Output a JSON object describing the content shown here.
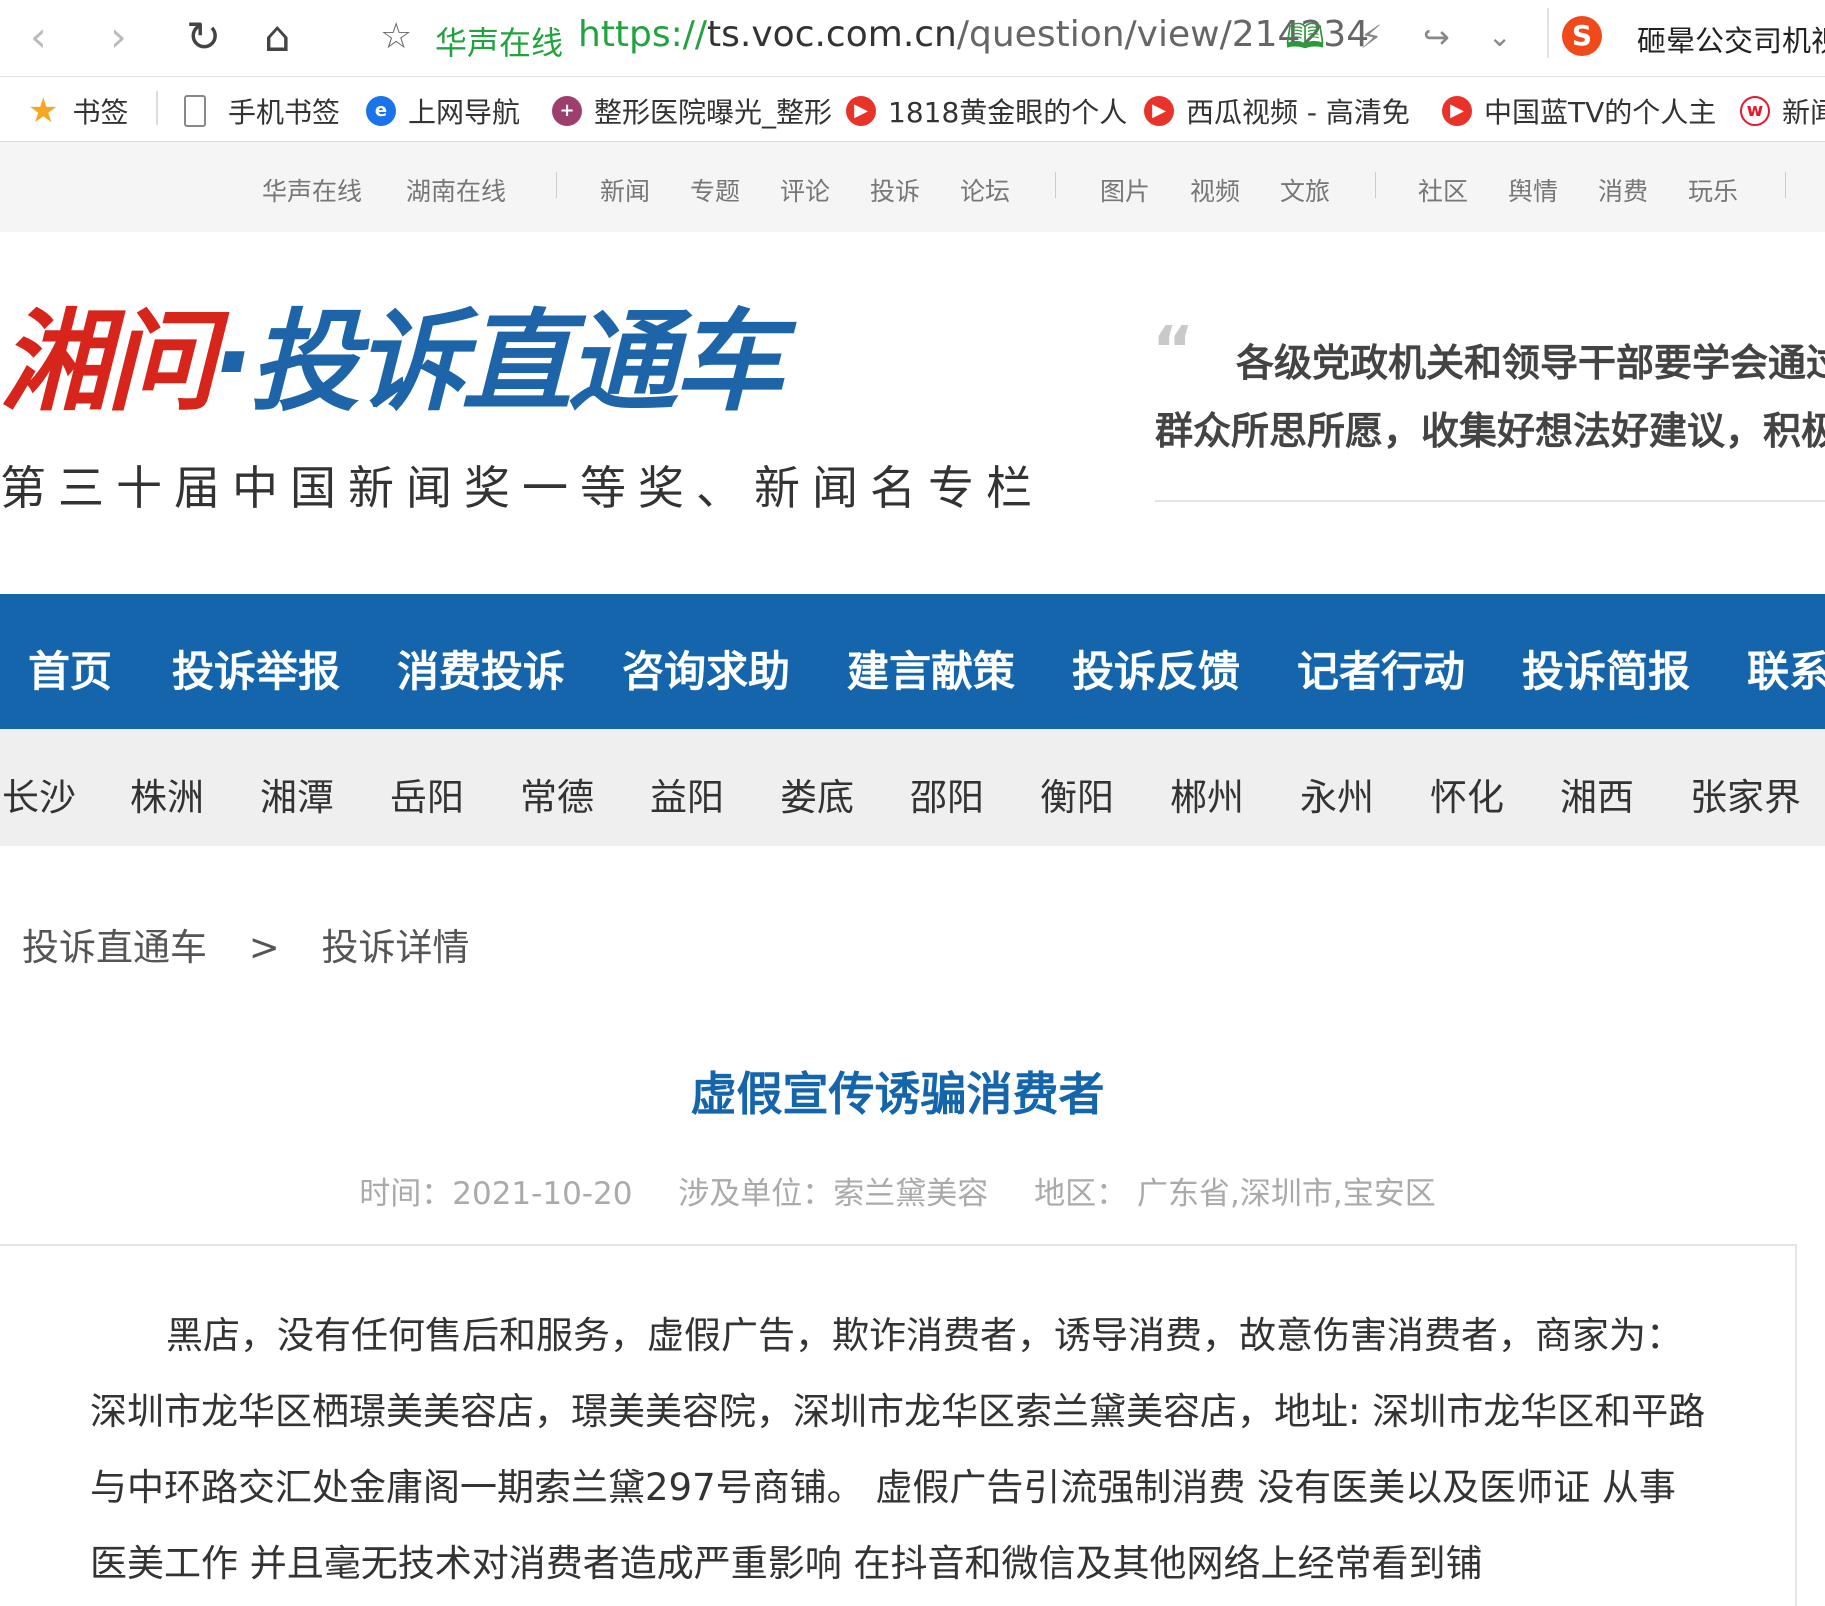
{
  "browser": {
    "site_name": "华声在线",
    "url_scheme": "https://",
    "url_host": "ts.voc.com.cn",
    "url_path": "/question/view/214234",
    "search_hint": "砸晕公交司机视",
    "icons": [
      "back-icon",
      "forward-icon",
      "reload-icon",
      "home-icon",
      "star-icon",
      "reader-icon",
      "lightning-icon",
      "share-icon",
      "chevron-down-icon",
      "sogou-icon"
    ]
  },
  "bookmarks": [
    {
      "label": "书签",
      "icon": "star-icon",
      "color": "#f5a623"
    },
    {
      "label": "手机书签",
      "icon": "phone-icon",
      "color": "#888888"
    },
    {
      "label": "上网导航",
      "icon": "ie-icon",
      "color": "#1a73e8"
    },
    {
      "label": "整形医院曝光_整形",
      "icon": "hospital-icon",
      "color": "#9c3f6c"
    },
    {
      "label": "1818黄金眼的个人",
      "icon": "video-icon",
      "color": "#e8322a"
    },
    {
      "label": "西瓜视频 - 高清免",
      "icon": "video-icon",
      "color": "#e8322a"
    },
    {
      "label": "中国蓝TV的个人主",
      "icon": "video-icon",
      "color": "#e8322a"
    },
    {
      "label": "新闻",
      "icon": "weibo-icon",
      "color": "#e6162d"
    }
  ],
  "site_nav": {
    "group1": [
      "华声在线",
      "湖南在线"
    ],
    "group2": [
      "新闻",
      "专题",
      "评论",
      "投诉",
      "论坛"
    ],
    "group3": [
      "图片",
      "视频",
      "文旅"
    ],
    "group4": [
      "社区",
      "舆情",
      "消费",
      "玩乐"
    ]
  },
  "header": {
    "logo_part1": "湘问",
    "logo_dot": "·",
    "logo_part2": "投诉直通车",
    "logo_sub": "第三十届中国新闻奖一等奖、新闻名专栏",
    "quote_line1": "各级党政机关和领导干部要学会通过",
    "quote_line2": "群众所思所愿，收集好想法好建议，积极"
  },
  "main_nav": [
    "首页",
    "投诉举报",
    "消费投诉",
    "咨询求助",
    "建言献策",
    "投诉反馈",
    "记者行动",
    "投诉简报",
    "联系"
  ],
  "city_nav": [
    "长沙",
    "株洲",
    "湘潭",
    "岳阳",
    "常德",
    "益阳",
    "娄底",
    "邵阳",
    "衡阳",
    "郴州",
    "永州",
    "怀化",
    "湘西",
    "张家界"
  ],
  "breadcrumb": {
    "root": "投诉直通车",
    "sep": ">",
    "current": "投诉详情"
  },
  "article": {
    "title": "虚假宣传诱骗消费者",
    "time": "时间：2021-10-20",
    "unit": "涉及单位：索兰黛美容",
    "region": "地区：  广东省,深圳市,宝安区",
    "body": "黑店，没有任何售后和服务，虚假广告，欺诈消费者，诱导消费，故意伤害消费者，商家为：深圳市龙华区栖璟美美容店，璟美美容院，深圳市龙华区索兰黛美容店，地址: 深圳市龙华区和平路与中环路交汇处金庸阁一期索兰黛297号商铺。 虚假广告引流强制消费 没有医美以及医师证 从事医美工作 并且毫无技术对消费者造成严重影响 在抖音和微信及其他网络上经常看到铺"
  }
}
